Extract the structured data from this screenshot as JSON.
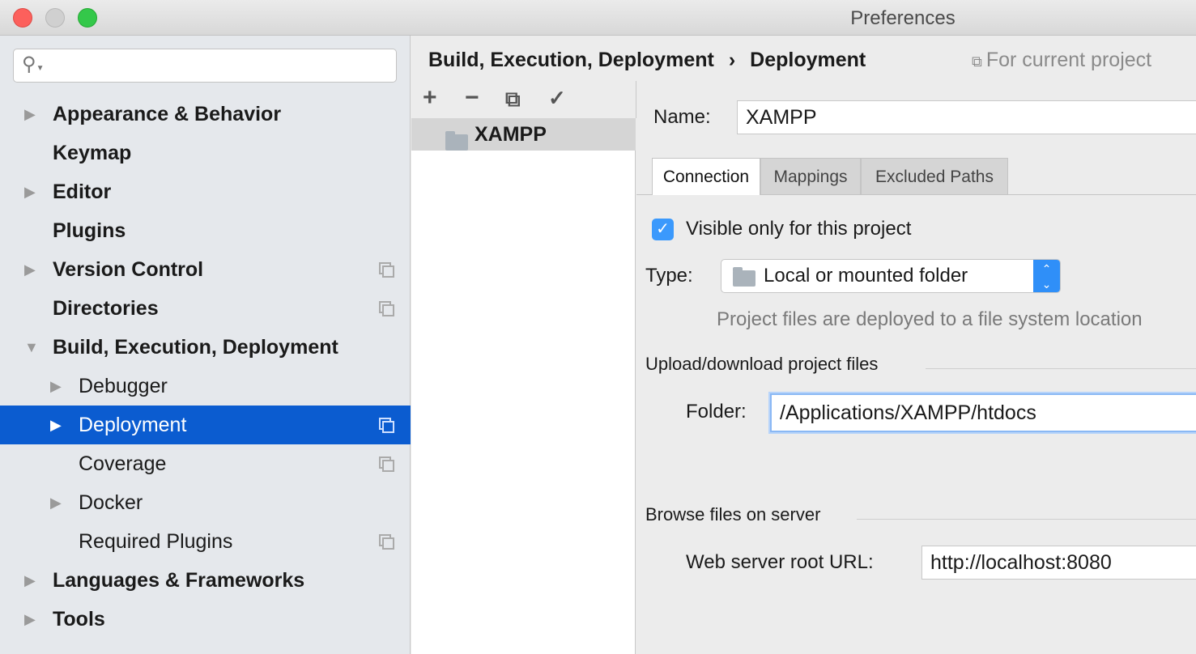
{
  "window": {
    "title": "Preferences"
  },
  "search": {
    "placeholder": ""
  },
  "sidebar": {
    "items": [
      {
        "label": "Appearance & Behavior",
        "arrow": "▶"
      },
      {
        "label": "Keymap"
      },
      {
        "label": "Editor",
        "arrow": "▶"
      },
      {
        "label": "Plugins"
      },
      {
        "label": "Version Control",
        "arrow": "▶",
        "copy": true
      },
      {
        "label": "Directories",
        "copy": true
      },
      {
        "label": "Build, Execution, Deployment",
        "arrow": "▼"
      },
      {
        "label": "Debugger",
        "arrow": "▶",
        "sub": true
      },
      {
        "label": "Deployment",
        "arrow": "▶",
        "sub": true,
        "copy": true,
        "selected": true
      },
      {
        "label": "Coverage",
        "sub": true,
        "copy": true
      },
      {
        "label": "Docker",
        "arrow": "▶",
        "sub": true
      },
      {
        "label": "Required Plugins",
        "sub": true,
        "copy": true
      },
      {
        "label": "Languages & Frameworks",
        "arrow": "▶"
      },
      {
        "label": "Tools",
        "arrow": "▶"
      }
    ]
  },
  "breadcrumb": {
    "parent": "Build, Execution, Deployment",
    "sep": "›",
    "current": "Deployment",
    "scope": "For current project"
  },
  "toolbar": {
    "add": "+",
    "remove": "−",
    "copy": "⧉",
    "default": "✓"
  },
  "servers": [
    {
      "name": "XAMPP"
    }
  ],
  "form": {
    "name_label": "Name:",
    "name_value": "XAMPP",
    "tabs": [
      "Connection",
      "Mappings",
      "Excluded Paths"
    ],
    "visible_label": "Visible only for this project",
    "type_label": "Type:",
    "type_value": "Local or mounted folder",
    "type_hint": "Project files are deployed to a file system location",
    "upload_section": "Upload/download project files",
    "folder_label": "Folder:",
    "folder_value": "/Applications/XAMPP/htdocs",
    "browse_section": "Browse files on server",
    "url_label": "Web server root URL:",
    "url_value": "http://localhost:8080"
  }
}
